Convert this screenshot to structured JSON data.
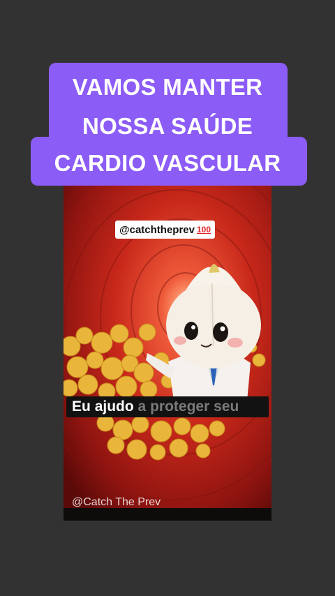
{
  "banner": {
    "lines": [
      "VAMOS MANTER",
      "NOSSA SAÚDE",
      "CARDIO VASCULAR"
    ],
    "color": "#8c5cf6"
  },
  "video": {
    "handle_tag": "@catchtheprev",
    "handle_emoji": "100",
    "subtitle": {
      "words_spoken": [
        "Eu",
        "ajudo"
      ],
      "words_pending": [
        "a",
        "proteger",
        "seu"
      ]
    },
    "watermark": "@Catch The Prev",
    "scene_icon": "garlic-doctor-character-in-artery"
  },
  "colors": {
    "background": "#333233",
    "banner": "#8c5cf6",
    "artery": "#c0291b",
    "plaque": "#e9b53a"
  }
}
